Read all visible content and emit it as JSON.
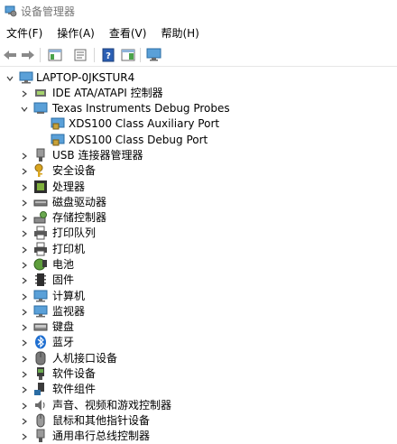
{
  "window": {
    "title": "设备管理器"
  },
  "menubar": {
    "items": [
      "文件(F)",
      "操作(A)",
      "查看(V)",
      "帮助(H)"
    ]
  },
  "tree": {
    "root": "LAPTOP-0JKSTUR4",
    "nodes": [
      {
        "label": "IDE ATA/ATAPI 控制器",
        "icon": "ide-controller-icon",
        "level": 1,
        "state": "collapsed"
      },
      {
        "label": "Texas Instruments Debug Probes",
        "icon": "debug-probe-icon",
        "level": 1,
        "state": "expanded"
      },
      {
        "label": "XDS100 Class Auxiliary Port",
        "icon": "debug-port-icon",
        "level": 2,
        "state": "leaf"
      },
      {
        "label": "XDS100 Class Debug Port",
        "icon": "debug-port-icon",
        "level": 2,
        "state": "leaf"
      },
      {
        "label": "USB 连接器管理器",
        "icon": "usb-connector-icon",
        "level": 1,
        "state": "collapsed"
      },
      {
        "label": "安全设备",
        "icon": "security-key-icon",
        "level": 1,
        "state": "collapsed"
      },
      {
        "label": "处理器",
        "icon": "processor-icon",
        "level": 1,
        "state": "collapsed"
      },
      {
        "label": "磁盘驱动器",
        "icon": "disk-drive-icon",
        "level": 1,
        "state": "collapsed"
      },
      {
        "label": "存储控制器",
        "icon": "storage-controller-icon",
        "level": 1,
        "state": "collapsed"
      },
      {
        "label": "打印队列",
        "icon": "print-queue-icon",
        "level": 1,
        "state": "collapsed"
      },
      {
        "label": "打印机",
        "icon": "printer-icon",
        "level": 1,
        "state": "collapsed"
      },
      {
        "label": "电池",
        "icon": "battery-icon",
        "level": 1,
        "state": "collapsed"
      },
      {
        "label": "固件",
        "icon": "firmware-icon",
        "level": 1,
        "state": "collapsed"
      },
      {
        "label": "计算机",
        "icon": "computer-icon",
        "level": 1,
        "state": "collapsed"
      },
      {
        "label": "监视器",
        "icon": "monitor-icon",
        "level": 1,
        "state": "collapsed"
      },
      {
        "label": "键盘",
        "icon": "keyboard-icon",
        "level": 1,
        "state": "collapsed"
      },
      {
        "label": "蓝牙",
        "icon": "bluetooth-icon",
        "level": 1,
        "state": "collapsed"
      },
      {
        "label": "人机接口设备",
        "icon": "hid-icon",
        "level": 1,
        "state": "collapsed"
      },
      {
        "label": "软件设备",
        "icon": "software-device-icon",
        "level": 1,
        "state": "collapsed"
      },
      {
        "label": "软件组件",
        "icon": "software-component-icon",
        "level": 1,
        "state": "collapsed"
      },
      {
        "label": "声音、视频和游戏控制器",
        "icon": "sound-icon",
        "level": 1,
        "state": "collapsed"
      },
      {
        "label": "鼠标和其他指针设备",
        "icon": "mouse-icon",
        "level": 1,
        "state": "collapsed"
      },
      {
        "label": "通用串行总线控制器",
        "icon": "usb-controller-icon",
        "level": 1,
        "state": "collapsed"
      }
    ]
  }
}
